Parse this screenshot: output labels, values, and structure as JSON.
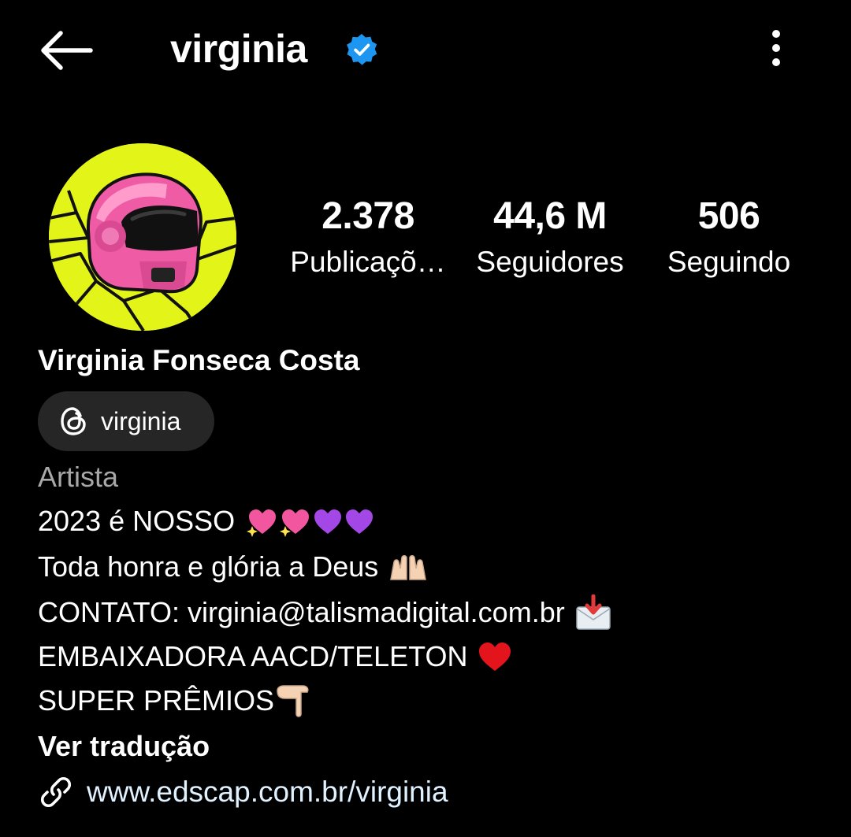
{
  "header": {
    "username": "virginia",
    "back_icon": "arrow-left-icon",
    "verified_icon": "verified-badge-icon",
    "more_icon": "more-vertical-icon",
    "verified_color": "#1c96f0"
  },
  "avatar": {
    "description_icon": "pink-helmet-avatar",
    "bg_color": "#e2f418",
    "helmet_color": "#f05ba5"
  },
  "stats": [
    {
      "value": "2.378",
      "label": "Publicaçõ…"
    },
    {
      "value": "44,6 M",
      "label": "Seguidores"
    },
    {
      "value": "506",
      "label": "Seguindo"
    }
  ],
  "profile": {
    "full_name": "Virginia Fonseca Costa",
    "threads_handle": "virginia",
    "threads_icon": "threads-icon",
    "category": "Artista",
    "bio": [
      {
        "text": "2023 é NOSSO",
        "emoji": [
          "sparkling-heart",
          "sparkling-heart",
          "purple-heart",
          "purple-heart"
        ]
      },
      {
        "text": "Toda honra e glória a Deus",
        "emoji": [
          "raising-hands"
        ]
      },
      {
        "text": "CONTATO: virginia@talismadigital.com.br",
        "emoji": [
          "inbox-envelope"
        ]
      },
      {
        "text": "EMBAIXADORA AACD/TELETON",
        "emoji": [
          "red-heart"
        ]
      },
      {
        "text": "SUPER PRÊMIOS",
        "emoji": [
          "pointing-down"
        ]
      }
    ],
    "translate_label": "Ver tradução",
    "link_icon": "link-icon",
    "link": "www.edscap.com.br/virginia"
  }
}
